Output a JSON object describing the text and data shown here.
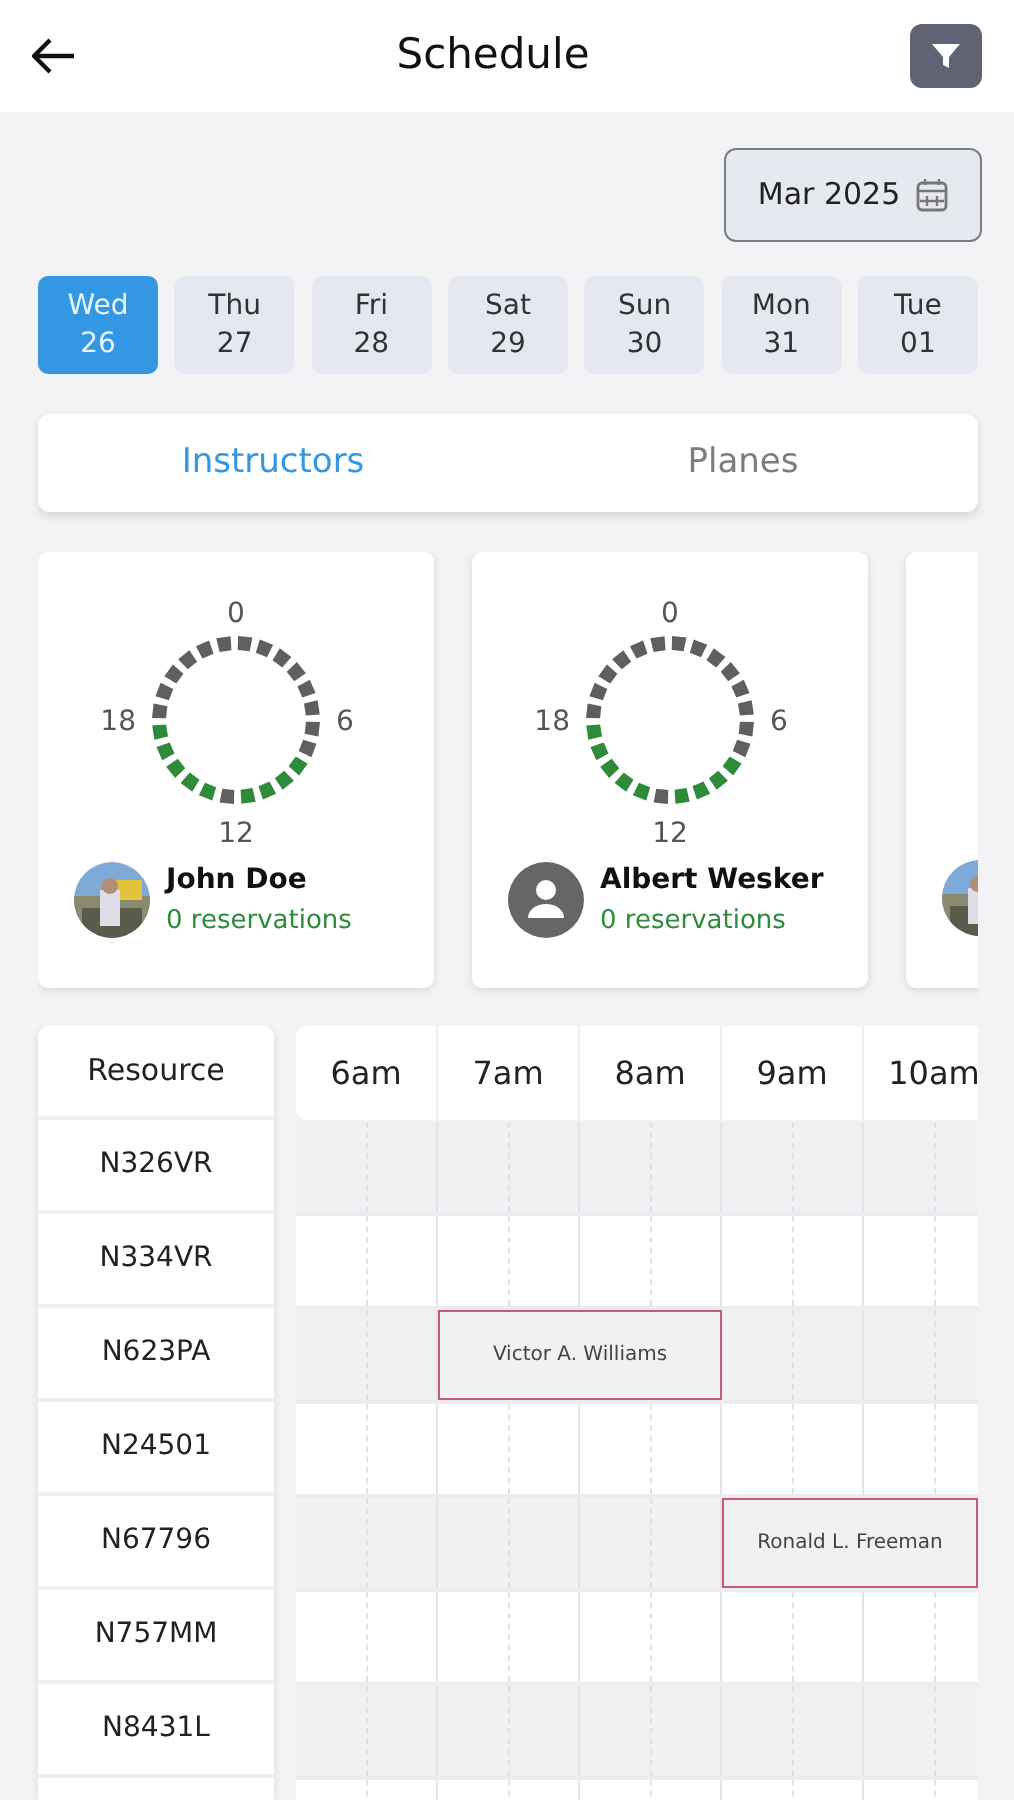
{
  "header": {
    "title": "Schedule"
  },
  "month_picker": {
    "value": "Mar 2025"
  },
  "days": [
    {
      "weekday": "Wed",
      "date": "26",
      "selected": true
    },
    {
      "weekday": "Thu",
      "date": "27",
      "selected": false
    },
    {
      "weekday": "Fri",
      "date": "28",
      "selected": false
    },
    {
      "weekday": "Sat",
      "date": "29",
      "selected": false
    },
    {
      "weekday": "Sun",
      "date": "30",
      "selected": false
    },
    {
      "weekday": "Mon",
      "date": "31",
      "selected": false
    },
    {
      "weekday": "Tue",
      "date": "01",
      "selected": false
    }
  ],
  "tabs": [
    {
      "label": "Instructors",
      "selected": true
    },
    {
      "label": "Planes",
      "selected": false
    }
  ],
  "instructors": [
    {
      "name": "John Doe",
      "reservations": "0 reservations",
      "avatar": {
        "kind": "picture"
      },
      "ring_labels": [
        "0",
        "6",
        "12",
        "18"
      ],
      "hours": [
        false,
        false,
        false,
        false,
        false,
        false,
        false,
        false,
        true,
        true,
        true,
        true,
        false,
        true,
        true,
        true,
        true,
        true,
        false,
        false,
        false,
        false,
        false,
        false
      ]
    },
    {
      "name": "Albert Wesker",
      "reservations": "0 reservations",
      "avatar": {
        "kind": "placeholder"
      },
      "ring_labels": [
        "0",
        "6",
        "12",
        "18"
      ],
      "hours": [
        false,
        false,
        false,
        false,
        false,
        false,
        false,
        false,
        true,
        true,
        true,
        true,
        false,
        true,
        true,
        true,
        true,
        true,
        false,
        false,
        false,
        false,
        false,
        false
      ]
    },
    {
      "avatar": {
        "kind": "picture"
      }
    }
  ],
  "grid": {
    "resource_heading": "Resource",
    "columns": [
      "6am",
      "7am",
      "8am",
      "9am",
      "10am"
    ],
    "rows": [
      {
        "resource": "N326VR",
        "cells": [
          {
            "kind": "free"
          },
          {
            "kind": "free"
          },
          {
            "kind": "free"
          },
          {
            "kind": "free"
          },
          {
            "kind": "free"
          }
        ]
      },
      {
        "resource": "N334VR",
        "cells": [
          {
            "kind": "free"
          },
          {
            "kind": "free"
          },
          {
            "kind": "free"
          },
          {
            "kind": "free"
          },
          {
            "kind": "free"
          }
        ]
      },
      {
        "resource": "N623PA",
        "cells": [
          {
            "kind": "free"
          },
          {
            "kind": "booked",
            "name": "Victor A. Williams"
          },
          {
            "kind": "continued"
          },
          {
            "kind": "free"
          },
          {
            "kind": "free"
          }
        ]
      },
      {
        "resource": "N24501",
        "cells": [
          {
            "kind": "free"
          },
          {
            "kind": "free"
          },
          {
            "kind": "free"
          },
          {
            "kind": "free"
          },
          {
            "kind": "free"
          }
        ]
      },
      {
        "resource": "N67796",
        "cells": [
          {
            "kind": "free"
          },
          {
            "kind": "free"
          },
          {
            "kind": "free"
          },
          {
            "kind": "booked",
            "name": "Ronald L. Freeman"
          },
          {
            "kind": "continued"
          }
        ]
      },
      {
        "resource": "N757MM",
        "cells": [
          {
            "kind": "free"
          },
          {
            "kind": "free"
          },
          {
            "kind": "free"
          },
          {
            "kind": "free"
          },
          {
            "kind": "free"
          }
        ]
      },
      {
        "resource": "N8431L",
        "cells": [
          {
            "kind": "free"
          },
          {
            "kind": "free"
          },
          {
            "kind": "free"
          },
          {
            "kind": "free"
          },
          {
            "kind": "free"
          }
        ]
      },
      {
        "cells": [
          {
            "kind": "free"
          },
          {
            "kind": "free"
          },
          {
            "kind": "free"
          },
          {
            "kind": "free"
          },
          {
            "kind": "free"
          }
        ]
      }
    ]
  }
}
